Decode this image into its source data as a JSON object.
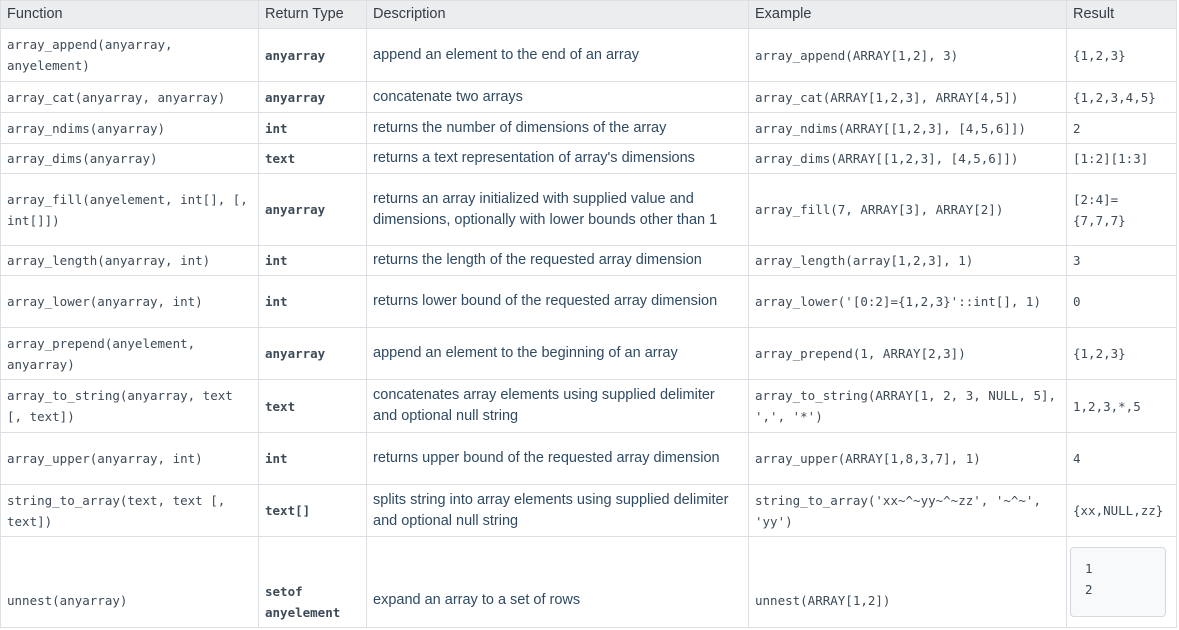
{
  "headers": {
    "function": "Function",
    "return_type": "Return Type",
    "description": "Description",
    "example": "Example",
    "result": "Result"
  },
  "rows": [
    {
      "function": "array_append(anyarray, anyelement)",
      "return_type": "anyarray",
      "description": "append an element to the end of an array",
      "example": "array_append(ARRAY[1,2], 3)",
      "result": "{1,2,3}"
    },
    {
      "function": "array_cat(anyarray, anyarray)",
      "return_type": "anyarray",
      "description": "concatenate two arrays",
      "example": "array_cat(ARRAY[1,2,3], ARRAY[4,5])",
      "result": "{1,2,3,4,5}"
    },
    {
      "function": "array_ndims(anyarray)",
      "return_type": "int",
      "description": "returns the number of dimensions of the array",
      "example": "array_ndims(ARRAY[[1,2,3], [4,5,6]])",
      "result": "2"
    },
    {
      "function": "array_dims(anyarray)",
      "return_type": "text",
      "description": "returns a text representation of array's dimensions",
      "example": "array_dims(ARRAY[[1,2,3], [4,5,6]])",
      "result": "[1:2][1:3]"
    },
    {
      "function": "array_fill(anyelement, int[], [, int[]])",
      "return_type": "anyarray",
      "description": "returns an array initialized with supplied value and dimensions, optionally with lower bounds other than 1",
      "example": "array_fill(7, ARRAY[3], ARRAY[2])",
      "result": "[2:4]={7,7,7}"
    },
    {
      "function": "array_length(anyarray, int)",
      "return_type": "int",
      "description": "returns the length of the requested array dimension",
      "example": "array_length(array[1,2,3], 1)",
      "result": "3"
    },
    {
      "function": "array_lower(anyarray, int)",
      "return_type": "int",
      "description": "returns lower bound of the requested array dimension",
      "example": "array_lower('[0:2]={1,2,3}'::int[], 1)",
      "result": "0"
    },
    {
      "function": "array_prepend(anyelement, anyarray)",
      "return_type": "anyarray",
      "description": "append an element to the beginning of an array",
      "example": "array_prepend(1, ARRAY[2,3])",
      "result": "{1,2,3}"
    },
    {
      "function": "array_to_string(anyarray, text [, text])",
      "return_type": "text",
      "description": "concatenates array elements using supplied delimiter and optional null string",
      "example": "array_to_string(ARRAY[1, 2, 3, NULL, 5], ',', '*')",
      "result": "1,2,3,*,5"
    },
    {
      "function": "array_upper(anyarray, int)",
      "return_type": "int",
      "description": "returns upper bound of the requested array dimension",
      "example": "array_upper(ARRAY[1,8,3,7], 1)",
      "result": "4"
    },
    {
      "function": "string_to_array(text, text [, text])",
      "return_type": "text[]",
      "description": "splits string into array elements using supplied delimiter and optional null string",
      "example": "string_to_array('xx~^~yy~^~zz', '~^~', 'yy')",
      "result": "{xx,NULL,zz}"
    },
    {
      "function": "unnest(anyarray)",
      "return_type": "setof anyelement",
      "description": "expand an array to a set of rows",
      "example": "unnest(ARRAY[1,2])",
      "result_lines": [
        "1",
        "2"
      ]
    }
  ]
}
